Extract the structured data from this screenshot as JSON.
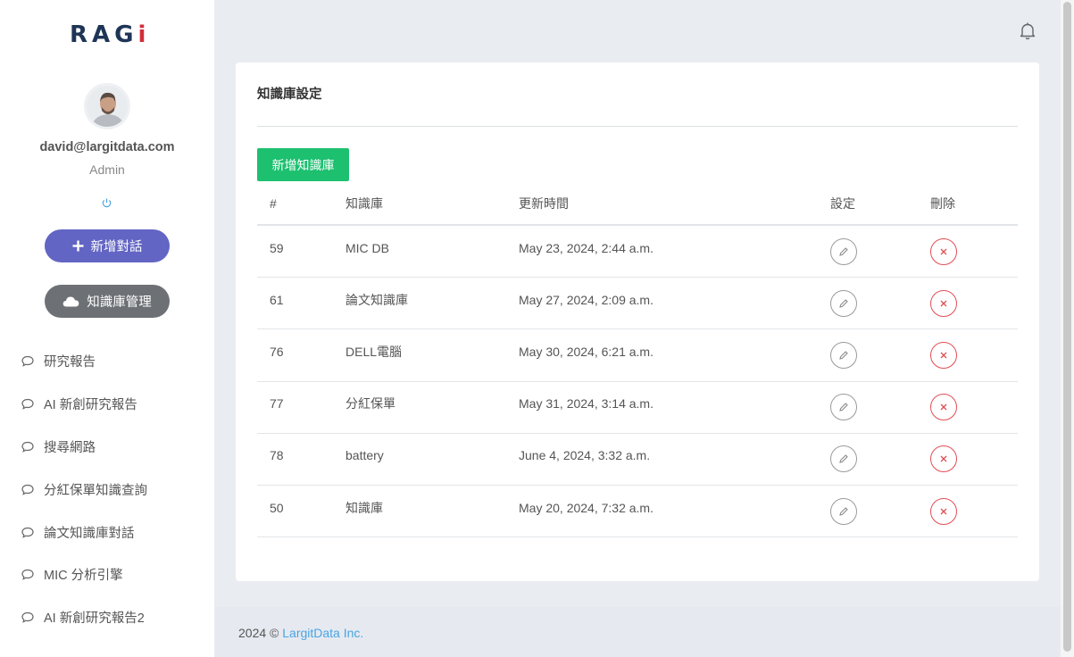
{
  "app": {
    "logo_text_a": "RA",
    "logo_text_b": "G",
    "logo_text_c": "i"
  },
  "user": {
    "email": "david@largitdata.com",
    "role": "Admin"
  },
  "sidebar": {
    "new_chat_label": "新增對話",
    "kb_manage_label": "知識庫管理",
    "items": [
      {
        "label": "研究報告"
      },
      {
        "label": "AI 新創研究報告"
      },
      {
        "label": "搜尋網路"
      },
      {
        "label": "分紅保單知識查詢"
      },
      {
        "label": "論文知識庫對話"
      },
      {
        "label": "MIC 分析引擎"
      },
      {
        "label": "AI 新創研究報告2"
      }
    ]
  },
  "page": {
    "title": "知識庫設定",
    "add_button_label": "新增知識庫"
  },
  "table": {
    "headers": {
      "id": "#",
      "name": "知識庫",
      "updated": "更新時間",
      "settings": "設定",
      "delete": "刪除"
    },
    "rows": [
      {
        "id": "59",
        "name": "MIC DB",
        "updated": "May 23, 2024, 2:44 a.m."
      },
      {
        "id": "61",
        "name": "論文知識庫",
        "updated": "May 27, 2024, 2:09 a.m."
      },
      {
        "id": "76",
        "name": "DELL電腦",
        "updated": "May 30, 2024, 6:21 a.m."
      },
      {
        "id": "77",
        "name": "分紅保單",
        "updated": "May 31, 2024, 3:14 a.m."
      },
      {
        "id": "78",
        "name": "battery",
        "updated": "June 4, 2024, 3:32 a.m."
      },
      {
        "id": "50",
        "name": "知識庫",
        "updated": "May 20, 2024, 7:32 a.m."
      }
    ]
  },
  "footer": {
    "copyright": "2024 © ",
    "company": "LargitData Inc."
  },
  "colors": {
    "primary_button": "#6265c3",
    "secondary_button": "#6d7175",
    "add_button": "#1cc06f",
    "delete_red": "#e24d55",
    "link_blue": "#4aa4e4"
  }
}
